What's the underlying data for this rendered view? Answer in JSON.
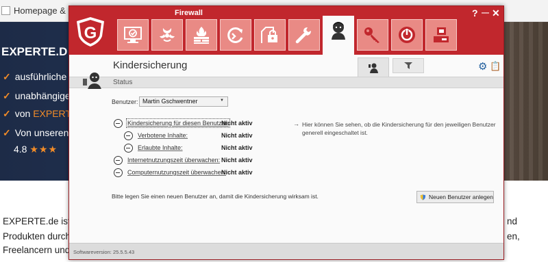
{
  "background_page": {
    "tab_label": "Homepage & Ho",
    "hero_title": "EXPERTE.D",
    "hero_items": [
      {
        "text": "ausführliche P",
        "highlight": ""
      },
      {
        "text": "unabhängige",
        "highlight": ""
      },
      {
        "text": "von ",
        "highlight": "EXPERTE"
      },
      {
        "text": "Von unseren",
        "highlight": ""
      }
    ],
    "rating_value": "4.8",
    "rating_stars": "★★★",
    "body_left": [
      "EXPERTE.de ist d",
      "Produkten durch u",
      "Freelancern und K"
    ],
    "body_right": [
      "nd",
      "en,"
    ]
  },
  "window": {
    "title": "Firewall",
    "controls": {
      "help": "?",
      "minimize": "—",
      "close": "✕"
    },
    "nav_icons": [
      "security-center-icon",
      "virus-protection-icon",
      "firewall-icon",
      "backup-icon",
      "encryption-icon",
      "tuner-icon",
      "parental-control-icon",
      "password-manager-icon",
      "autostart-manager-icon",
      "device-control-icon"
    ],
    "page_title": "Kindersicherung",
    "section_label": "Status",
    "user_label": "Benutzer:",
    "user_selected": "Martin Gschwentner",
    "rows": [
      {
        "label": "Kindersicherung für diesen Benutzer:",
        "status": "Nicht aktiv"
      },
      {
        "label": "Verbotene Inhalte:",
        "status": "Nicht aktiv"
      },
      {
        "label": "Erlaubte Inhalte:",
        "status": "Nicht aktiv"
      },
      {
        "label": "Internetnutzungszeit überwachen:",
        "status": "Nicht aktiv"
      },
      {
        "label": "Computernutzungszeit überwachen:",
        "status": "Nicht aktiv"
      }
    ],
    "hint_arrow": "→",
    "hint_text": "Hier können Sie sehen, ob die Kindersicherung für den jeweiligen Benutzer generell eingeschaltet ist.",
    "notice": "Bitte legen Sie einen neuen Benutzer an, damit die Kindersicherung wirksam ist.",
    "new_user_button": "Neuen Benutzer anlegen",
    "version": "Softwareversion: 25.5.5.43",
    "colors": {
      "brand_red": "#c1272d",
      "tile_red": "#e98a85",
      "accent_blue": "#1f5d9c"
    }
  }
}
